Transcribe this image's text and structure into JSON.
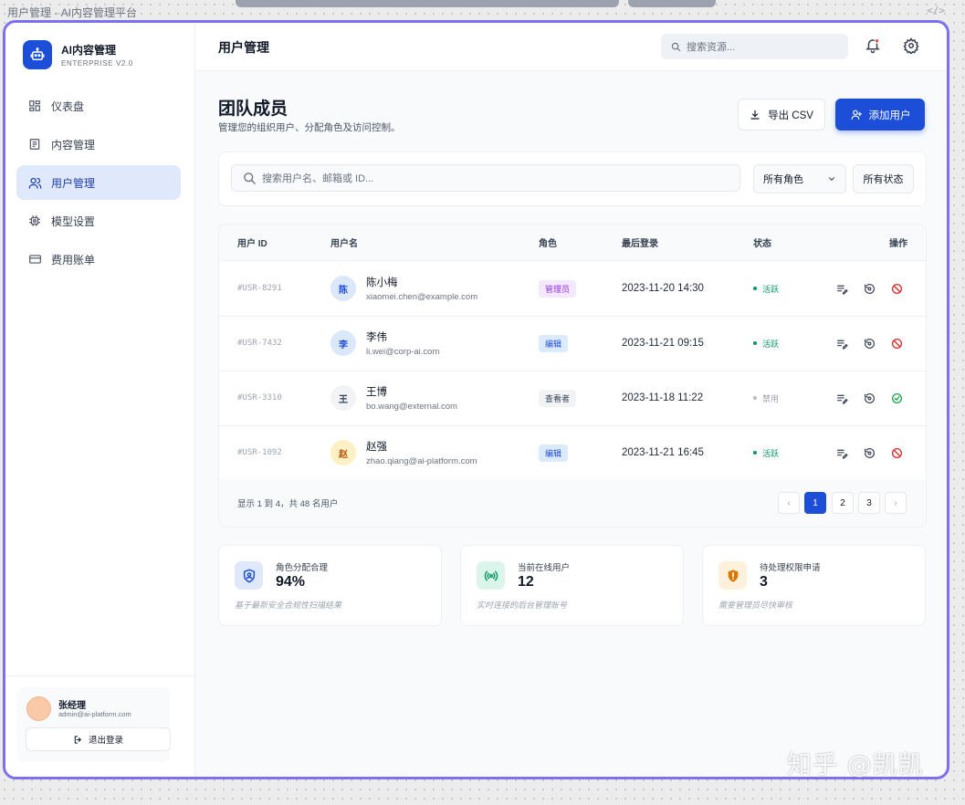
{
  "document_title": "用户管理 - AI内容管理平台",
  "brand": {
    "name": "AI内容管理",
    "edition": "ENTERPRISE V2.0"
  },
  "nav": [
    {
      "label": "仪表盘",
      "icon": "dashboard-icon",
      "active": false
    },
    {
      "label": "内容管理",
      "icon": "document-icon",
      "active": false
    },
    {
      "label": "用户管理",
      "icon": "users-icon",
      "active": true
    },
    {
      "label": "模型设置",
      "icon": "chip-icon",
      "active": false
    },
    {
      "label": "费用账单",
      "icon": "credit-card-icon",
      "active": false
    }
  ],
  "account": {
    "name": "张经理",
    "email": "admin@ai-platform.com",
    "logout_label": "退出登录"
  },
  "topbar": {
    "title": "用户管理",
    "search_placeholder": "搜索资源..."
  },
  "header": {
    "title": "团队成员",
    "subtitle": "管理您的组织用户、分配角色及访问控制。",
    "export_label": "导出 CSV",
    "add_label": "添加用户"
  },
  "filters": {
    "search_placeholder": "搜索用户名、邮箱或 ID...",
    "role_value": "所有角色",
    "status_value": "所有状态"
  },
  "table": {
    "columns": [
      "用户 ID",
      "用户名",
      "角色",
      "最后登录",
      "状态",
      "操作"
    ],
    "rows": [
      {
        "id": "#USR-8291",
        "avatar": "陈",
        "name": "陈小梅",
        "email": "xiaomei.chen@example.com",
        "role": "管理员",
        "last_login": "2023-11-20 14:30",
        "status": "活跃",
        "active": true
      },
      {
        "id": "#USR-7432",
        "avatar": "李",
        "name": "李伟",
        "email": "li.wei@corp-ai.com",
        "role": "编辑",
        "last_login": "2023-11-21 09:15",
        "status": "活跃",
        "active": true
      },
      {
        "id": "#USR-3310",
        "avatar": "王",
        "name": "王博",
        "email": "bo.wang@external.com",
        "role": "查看者",
        "last_login": "2023-11-18 11:22",
        "status": "禁用",
        "active": false
      },
      {
        "id": "#USR-1092",
        "avatar": "赵",
        "name": "赵强",
        "email": "zhao.qiang@ai-platform.com",
        "role": "编辑",
        "last_login": "2023-11-21 16:45",
        "status": "活跃",
        "active": true
      }
    ],
    "footer_text": "显示 1 到 4，共 48 名用户",
    "pages": [
      "1",
      "2",
      "3"
    ],
    "current_page": "1",
    "prev_label": "‹",
    "next_label": "›"
  },
  "stats": [
    {
      "label": "角色分配合理",
      "value": "94%",
      "note": "基于最新安全合规性扫描结果",
      "icon": "shield-user-icon",
      "color": "#1d4ed8",
      "bg": "#e0e9fb"
    },
    {
      "label": "当前在线用户",
      "value": "12",
      "note": "实时连接的后台管理账号",
      "icon": "broadcast-icon",
      "color": "#059669",
      "bg": "#dcf5ea"
    },
    {
      "label": "待处理权限申请",
      "value": "3",
      "note": "需要管理员尽快审核",
      "icon": "warning-shield-icon",
      "color": "#d97706",
      "bg": "#fdf1dc"
    }
  ],
  "colors": {
    "primary": "#1d4ed8",
    "active_status": "#059669",
    "disabled_status": "#9ca3af",
    "danger": "#dc2626",
    "success": "#16a34a"
  },
  "watermark": "知乎 @凯凯"
}
